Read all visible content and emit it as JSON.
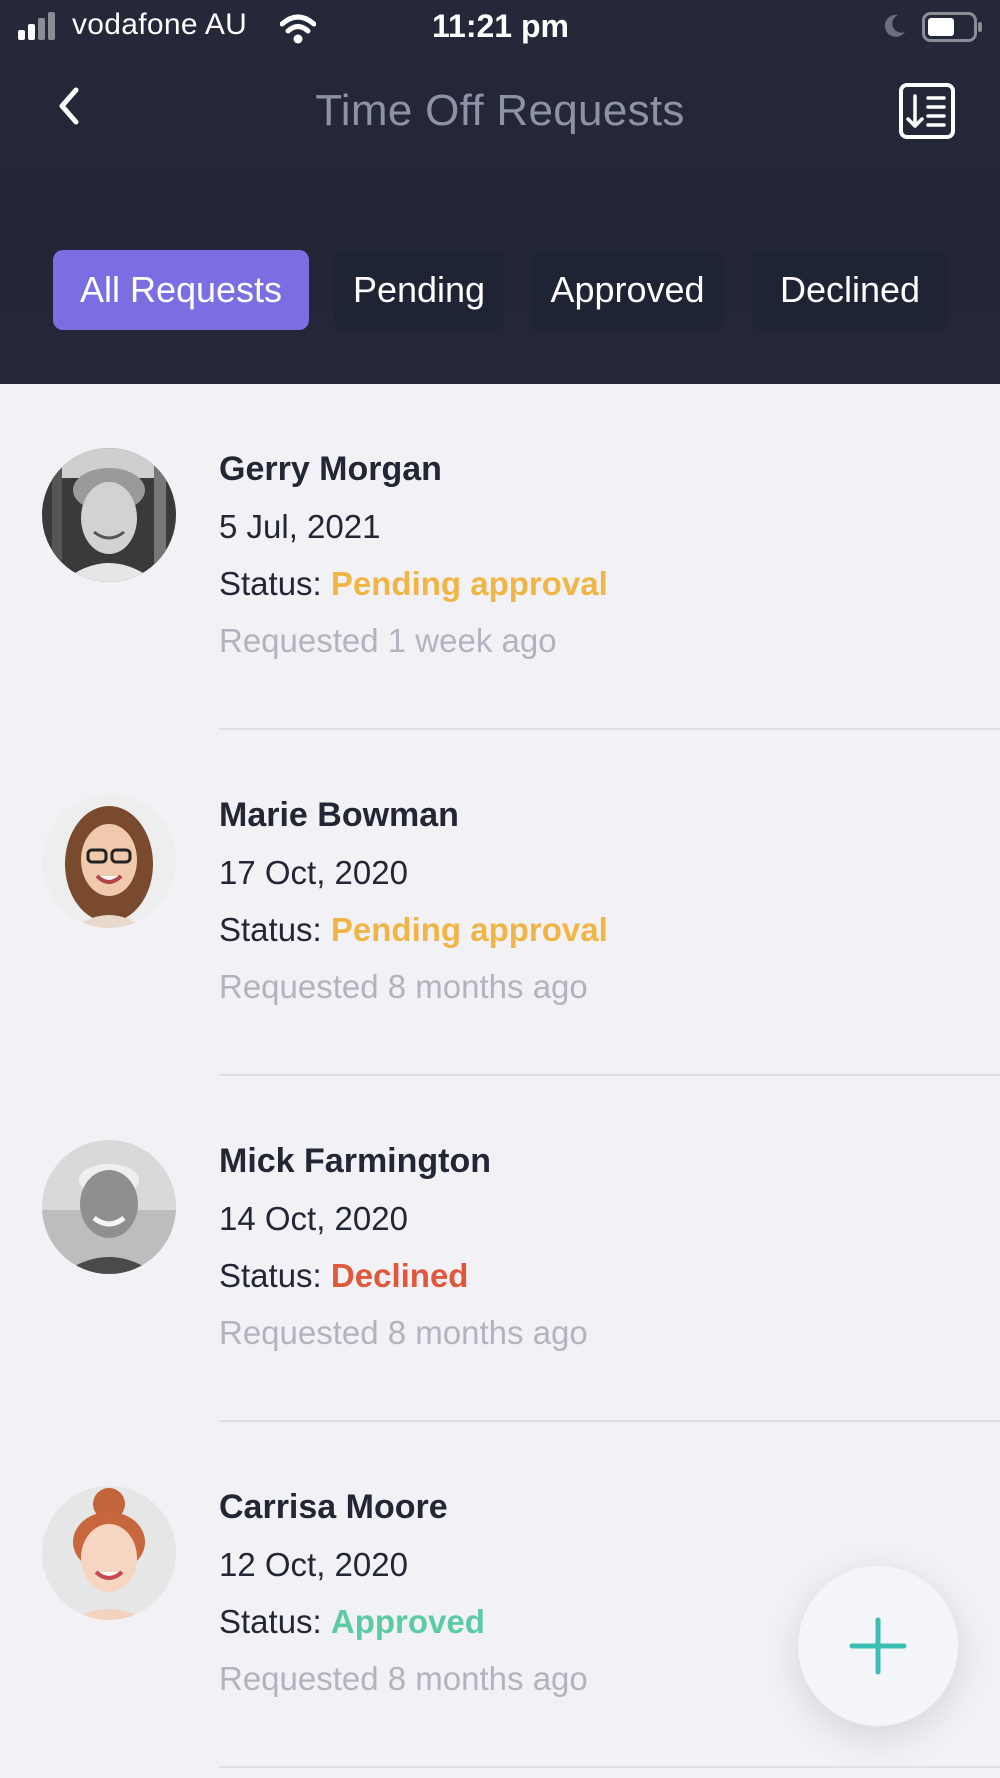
{
  "status_bar": {
    "carrier": "vodafone AU",
    "time": "11:21 pm"
  },
  "header": {
    "title": "Time Off Requests"
  },
  "tabs": [
    {
      "label": "All Requests",
      "active": true
    },
    {
      "label": "Pending",
      "active": false
    },
    {
      "label": "Approved",
      "active": false
    },
    {
      "label": "Declined",
      "active": false
    }
  ],
  "colors": {
    "accent": "#7b6ee3",
    "pending": "#f0b545",
    "declined": "#e0573b",
    "approved": "#5dcaa6",
    "fab_plus": "#3bbfb5"
  },
  "requests": [
    {
      "name": "Gerry Morgan",
      "date": "5 Jul, 2021",
      "status_label": "Status:",
      "status": "Pending approval",
      "requested": "Requested 1 week ago"
    },
    {
      "name": "Marie Bowman",
      "date": "17 Oct, 2020",
      "status_label": "Status:",
      "status": "Pending approval",
      "requested": "Requested 8 months ago"
    },
    {
      "name": "Mick Farmington",
      "date": "14 Oct, 2020",
      "status_label": "Status:",
      "status": "Declined",
      "requested": "Requested 8 months ago"
    },
    {
      "name": "Carrisa Moore",
      "date": "12 Oct, 2020",
      "status_label": "Status:",
      "status": "Approved",
      "requested": "Requested 8 months ago"
    }
  ],
  "icons": {
    "back": "chevron-left-icon",
    "sort": "sort-list-icon",
    "fab": "plus-icon"
  }
}
